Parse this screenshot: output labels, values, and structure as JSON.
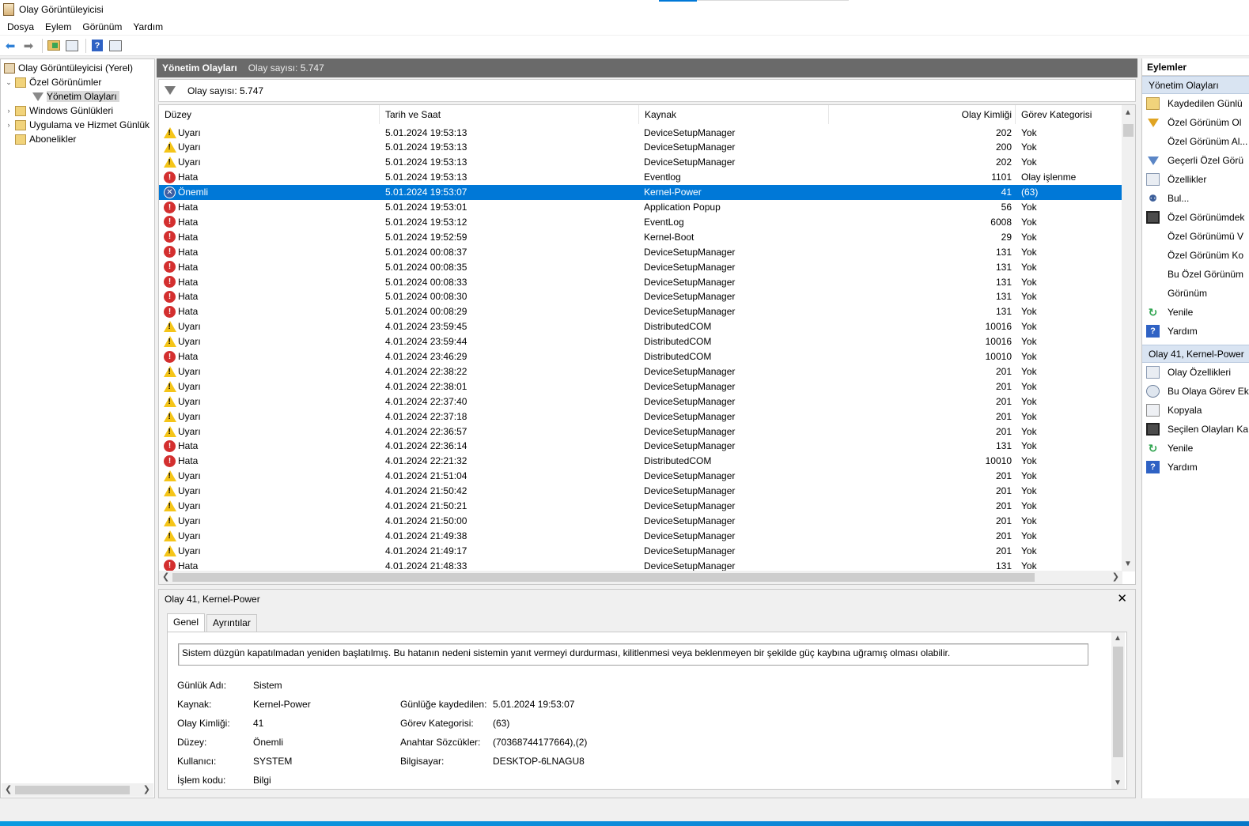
{
  "window": {
    "title": "Olay Görüntüleyicisi"
  },
  "menu": [
    "Dosya",
    "Eylem",
    "Görünüm",
    "Yardım"
  ],
  "toolbar": {
    "buttons": [
      "back-icon",
      "forward-icon",
      "open-folder-icon",
      "show-hide-tree-icon",
      "help-icon",
      "show-hide-action-pane-icon"
    ]
  },
  "tree": {
    "root": "Olay Görüntüleyicisi (Yerel)",
    "custom_views": "Özel Görünümler",
    "admin_events": "Yönetim Olayları",
    "windows_logs": "Windows Günlükleri",
    "app_service_logs": "Uygulama ve Hizmet Günlük",
    "subscriptions": "Abonelikler"
  },
  "center": {
    "title": "Yönetim Olayları",
    "count": "Olay sayısı: 5.747",
    "filter_count": "Olay sayısı: 5.747"
  },
  "columns": [
    "Düzey",
    "Tarih ve Saat",
    "Kaynak",
    "Olay Kimliği",
    "Görev Kategorisi"
  ],
  "events": [
    {
      "level": "Uyarı",
      "type": "warning",
      "date": "5.01.2024 19:53:13",
      "source": "DeviceSetupManager",
      "id": "202",
      "category": "Yok"
    },
    {
      "level": "Uyarı",
      "type": "warning",
      "date": "5.01.2024 19:53:13",
      "source": "DeviceSetupManager",
      "id": "200",
      "category": "Yok"
    },
    {
      "level": "Uyarı",
      "type": "warning",
      "date": "5.01.2024 19:53:13",
      "source": "DeviceSetupManager",
      "id": "202",
      "category": "Yok"
    },
    {
      "level": "Hata",
      "type": "error",
      "date": "5.01.2024 19:53:13",
      "source": "Eventlog",
      "id": "1101",
      "category": "Olay işlenme"
    },
    {
      "level": "Önemli",
      "type": "critical",
      "date": "5.01.2024 19:53:07",
      "source": "Kernel-Power",
      "id": "41",
      "category": "(63)",
      "selected": true
    },
    {
      "level": "Hata",
      "type": "error",
      "date": "5.01.2024 19:53:01",
      "source": "Application Popup",
      "id": "56",
      "category": "Yok"
    },
    {
      "level": "Hata",
      "type": "error",
      "date": "5.01.2024 19:53:12",
      "source": "EventLog",
      "id": "6008",
      "category": "Yok"
    },
    {
      "level": "Hata",
      "type": "error",
      "date": "5.01.2024 19:52:59",
      "source": "Kernel-Boot",
      "id": "29",
      "category": "Yok"
    },
    {
      "level": "Hata",
      "type": "error",
      "date": "5.01.2024 00:08:37",
      "source": "DeviceSetupManager",
      "id": "131",
      "category": "Yok"
    },
    {
      "level": "Hata",
      "type": "error",
      "date": "5.01.2024 00:08:35",
      "source": "DeviceSetupManager",
      "id": "131",
      "category": "Yok"
    },
    {
      "level": "Hata",
      "type": "error",
      "date": "5.01.2024 00:08:33",
      "source": "DeviceSetupManager",
      "id": "131",
      "category": "Yok"
    },
    {
      "level": "Hata",
      "type": "error",
      "date": "5.01.2024 00:08:30",
      "source": "DeviceSetupManager",
      "id": "131",
      "category": "Yok"
    },
    {
      "level": "Hata",
      "type": "error",
      "date": "5.01.2024 00:08:29",
      "source": "DeviceSetupManager",
      "id": "131",
      "category": "Yok"
    },
    {
      "level": "Uyarı",
      "type": "warning",
      "date": "4.01.2024 23:59:45",
      "source": "DistributedCOM",
      "id": "10016",
      "category": "Yok"
    },
    {
      "level": "Uyarı",
      "type": "warning",
      "date": "4.01.2024 23:59:44",
      "source": "DistributedCOM",
      "id": "10016",
      "category": "Yok"
    },
    {
      "level": "Hata",
      "type": "error",
      "date": "4.01.2024 23:46:29",
      "source": "DistributedCOM",
      "id": "10010",
      "category": "Yok"
    },
    {
      "level": "Uyarı",
      "type": "warning",
      "date": "4.01.2024 22:38:22",
      "source": "DeviceSetupManager",
      "id": "201",
      "category": "Yok"
    },
    {
      "level": "Uyarı",
      "type": "warning",
      "date": "4.01.2024 22:38:01",
      "source": "DeviceSetupManager",
      "id": "201",
      "category": "Yok"
    },
    {
      "level": "Uyarı",
      "type": "warning",
      "date": "4.01.2024 22:37:40",
      "source": "DeviceSetupManager",
      "id": "201",
      "category": "Yok"
    },
    {
      "level": "Uyarı",
      "type": "warning",
      "date": "4.01.2024 22:37:18",
      "source": "DeviceSetupManager",
      "id": "201",
      "category": "Yok"
    },
    {
      "level": "Uyarı",
      "type": "warning",
      "date": "4.01.2024 22:36:57",
      "source": "DeviceSetupManager",
      "id": "201",
      "category": "Yok"
    },
    {
      "level": "Hata",
      "type": "error",
      "date": "4.01.2024 22:36:14",
      "source": "DeviceSetupManager",
      "id": "131",
      "category": "Yok"
    },
    {
      "level": "Hata",
      "type": "error",
      "date": "4.01.2024 22:21:32",
      "source": "DistributedCOM",
      "id": "10010",
      "category": "Yok"
    },
    {
      "level": "Uyarı",
      "type": "warning",
      "date": "4.01.2024 21:51:04",
      "source": "DeviceSetupManager",
      "id": "201",
      "category": "Yok"
    },
    {
      "level": "Uyarı",
      "type": "warning",
      "date": "4.01.2024 21:50:42",
      "source": "DeviceSetupManager",
      "id": "201",
      "category": "Yok"
    },
    {
      "level": "Uyarı",
      "type": "warning",
      "date": "4.01.2024 21:50:21",
      "source": "DeviceSetupManager",
      "id": "201",
      "category": "Yok"
    },
    {
      "level": "Uyarı",
      "type": "warning",
      "date": "4.01.2024 21:50:00",
      "source": "DeviceSetupManager",
      "id": "201",
      "category": "Yok"
    },
    {
      "level": "Uyarı",
      "type": "warning",
      "date": "4.01.2024 21:49:38",
      "source": "DeviceSetupManager",
      "id": "201",
      "category": "Yok"
    },
    {
      "level": "Uyarı",
      "type": "warning",
      "date": "4.01.2024 21:49:17",
      "source": "DeviceSetupManager",
      "id": "201",
      "category": "Yok"
    },
    {
      "level": "Hata",
      "type": "error",
      "date": "4.01.2024 21:48:33",
      "source": "DeviceSetupManager",
      "id": "131",
      "category": "Yok"
    }
  ],
  "details": {
    "title": "Olay 41, Kernel-Power",
    "tabs": [
      "Genel",
      "Ayrıntılar"
    ],
    "description": "Sistem düzgün kapatılmadan yeniden başlatılmış. Bu hatanın nedeni sistemin yanıt vermeyi durdurması, kilitlenmesi veya beklenmeyen bir şekilde güç kaybına uğramış olması olabilir.",
    "fields_left": [
      {
        "label": "Günlük Adı:",
        "value": "Sistem"
      },
      {
        "label": "Kaynak:",
        "value": "Kernel-Power"
      },
      {
        "label": "Olay Kimliği:",
        "value": "41"
      },
      {
        "label": "Düzey:",
        "value": "Önemli"
      },
      {
        "label": "Kullanıcı:",
        "value": "SYSTEM"
      },
      {
        "label": "İşlem kodu:",
        "value": "Bilgi"
      }
    ],
    "fields_right": [
      {
        "label": "Günlüğe kaydedilen:",
        "value": "5.01.2024 19:53:07"
      },
      {
        "label": "Görev Kategorisi:",
        "value": "(63)"
      },
      {
        "label": "Anahtar Sözcükler:",
        "value": "(70368744177664),(2)"
      },
      {
        "label": "Bilgisayar:",
        "value": "DESKTOP-6LNAGU8"
      }
    ]
  },
  "actions": {
    "header": "Eylemler",
    "section1": "Yönetim Olayları",
    "items1": [
      {
        "icon": "open-log-icon",
        "label": "Kaydedilen Günlü"
      },
      {
        "icon": "create-view-icon",
        "label": "Özel Görünüm Ol"
      },
      {
        "icon": "",
        "label": "Özel Görünüm Al..."
      },
      {
        "icon": "filter-icon",
        "label": "Geçerli Özel Görü"
      },
      {
        "icon": "properties-icon",
        "label": "Özellikler"
      },
      {
        "icon": "find-icon",
        "label": "Bul..."
      },
      {
        "icon": "save-icon",
        "label": "Özel Görünümdek"
      },
      {
        "icon": "",
        "label": "Özel Görünümü V"
      },
      {
        "icon": "",
        "label": "Özel Görünüm Ko"
      },
      {
        "icon": "",
        "label": "Bu Özel Görünüm"
      },
      {
        "icon": "",
        "label": "Görünüm"
      },
      {
        "icon": "refresh-icon",
        "label": "Yenile"
      },
      {
        "icon": "help-icon",
        "label": "Yardım"
      }
    ],
    "section2": "Olay 41, Kernel-Power",
    "items2": [
      {
        "icon": "event-properties-icon",
        "label": "Olay Özellikleri"
      },
      {
        "icon": "attach-task-icon",
        "label": "Bu Olaya Görev Ek"
      },
      {
        "icon": "copy-icon",
        "label": "Kopyala"
      },
      {
        "icon": "save-icon",
        "label": "Seçilen Olayları Ka"
      },
      {
        "icon": "refresh-icon",
        "label": "Yenile"
      },
      {
        "icon": "help-icon",
        "label": "Yardım"
      }
    ]
  },
  "colors": {
    "selection": "#0078d7",
    "header_bar": "#6a6a6a",
    "action_section": "#d9e4f2"
  }
}
